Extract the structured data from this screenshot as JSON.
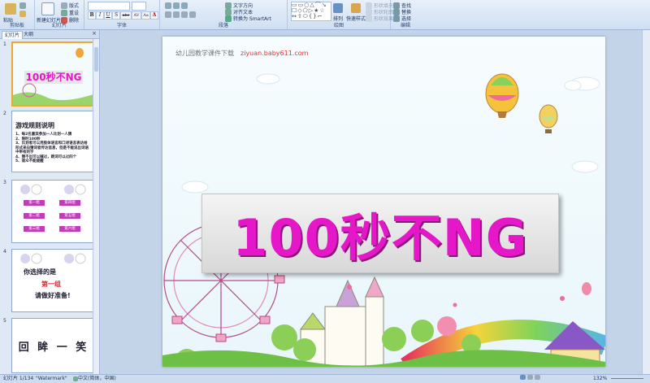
{
  "ribbon": {
    "groups": [
      {
        "label": "剪贴板",
        "buttons": [
          "粘贴",
          "剪切",
          "格式刷"
        ]
      },
      {
        "label": "幻灯片",
        "buttons": [
          "新建幻灯片",
          "版式",
          "重设",
          "删除"
        ]
      },
      {
        "label": "字体",
        "buttons": [
          "B",
          "I",
          "U",
          "S",
          "abc",
          "AV",
          "Aa",
          "A"
        ]
      },
      {
        "label": "段落",
        "buttons": [
          "文字方向",
          "对齐文本",
          "转换为 SmartArt"
        ]
      },
      {
        "label": "绘图",
        "buttons": [
          "排列",
          "快速样式",
          "形状填充",
          "形状轮廓",
          "形状效果"
        ]
      },
      {
        "label": "编辑",
        "buttons": [
          "查找",
          "替换",
          "选择"
        ]
      }
    ]
  },
  "pane": {
    "tabs": [
      "幻灯片",
      "大纲"
    ],
    "close": "×",
    "slides": [
      {
        "num": "1",
        "title": "100秒不NG"
      },
      {
        "num": "2",
        "title": "游戏规则说明",
        "lines": [
          "1、每2名嘉宾参加一人比划一人猜",
          "2、限时100秒",
          "3、比划者可以用肢体语言和口述语言表达给形式来向猜词者传达信息，但是不能说出词语中带有的字",
          "4、猜不出可以喊过，跳词可以过四个",
          "5、观众不能提醒"
        ]
      },
      {
        "num": "3",
        "chips": [
          "第一组",
          "第二组",
          "第三组",
          "第四组",
          "第五组",
          "第六组"
        ]
      },
      {
        "num": "4",
        "lines": [
          "你选择的是",
          "第一组",
          "请做好准备!"
        ]
      },
      {
        "num": "5",
        "title": "回 眸 一 笑"
      }
    ]
  },
  "slide": {
    "header_text": "幼儿园教学课件下载",
    "header_url": "ziyuan.baby611.com",
    "title": "100秒不NG"
  },
  "status": {
    "slide_info": "幻灯片 1/134",
    "theme": "\"Watermark\"",
    "language": "中文(简体，中国)",
    "zoom": "132%"
  }
}
